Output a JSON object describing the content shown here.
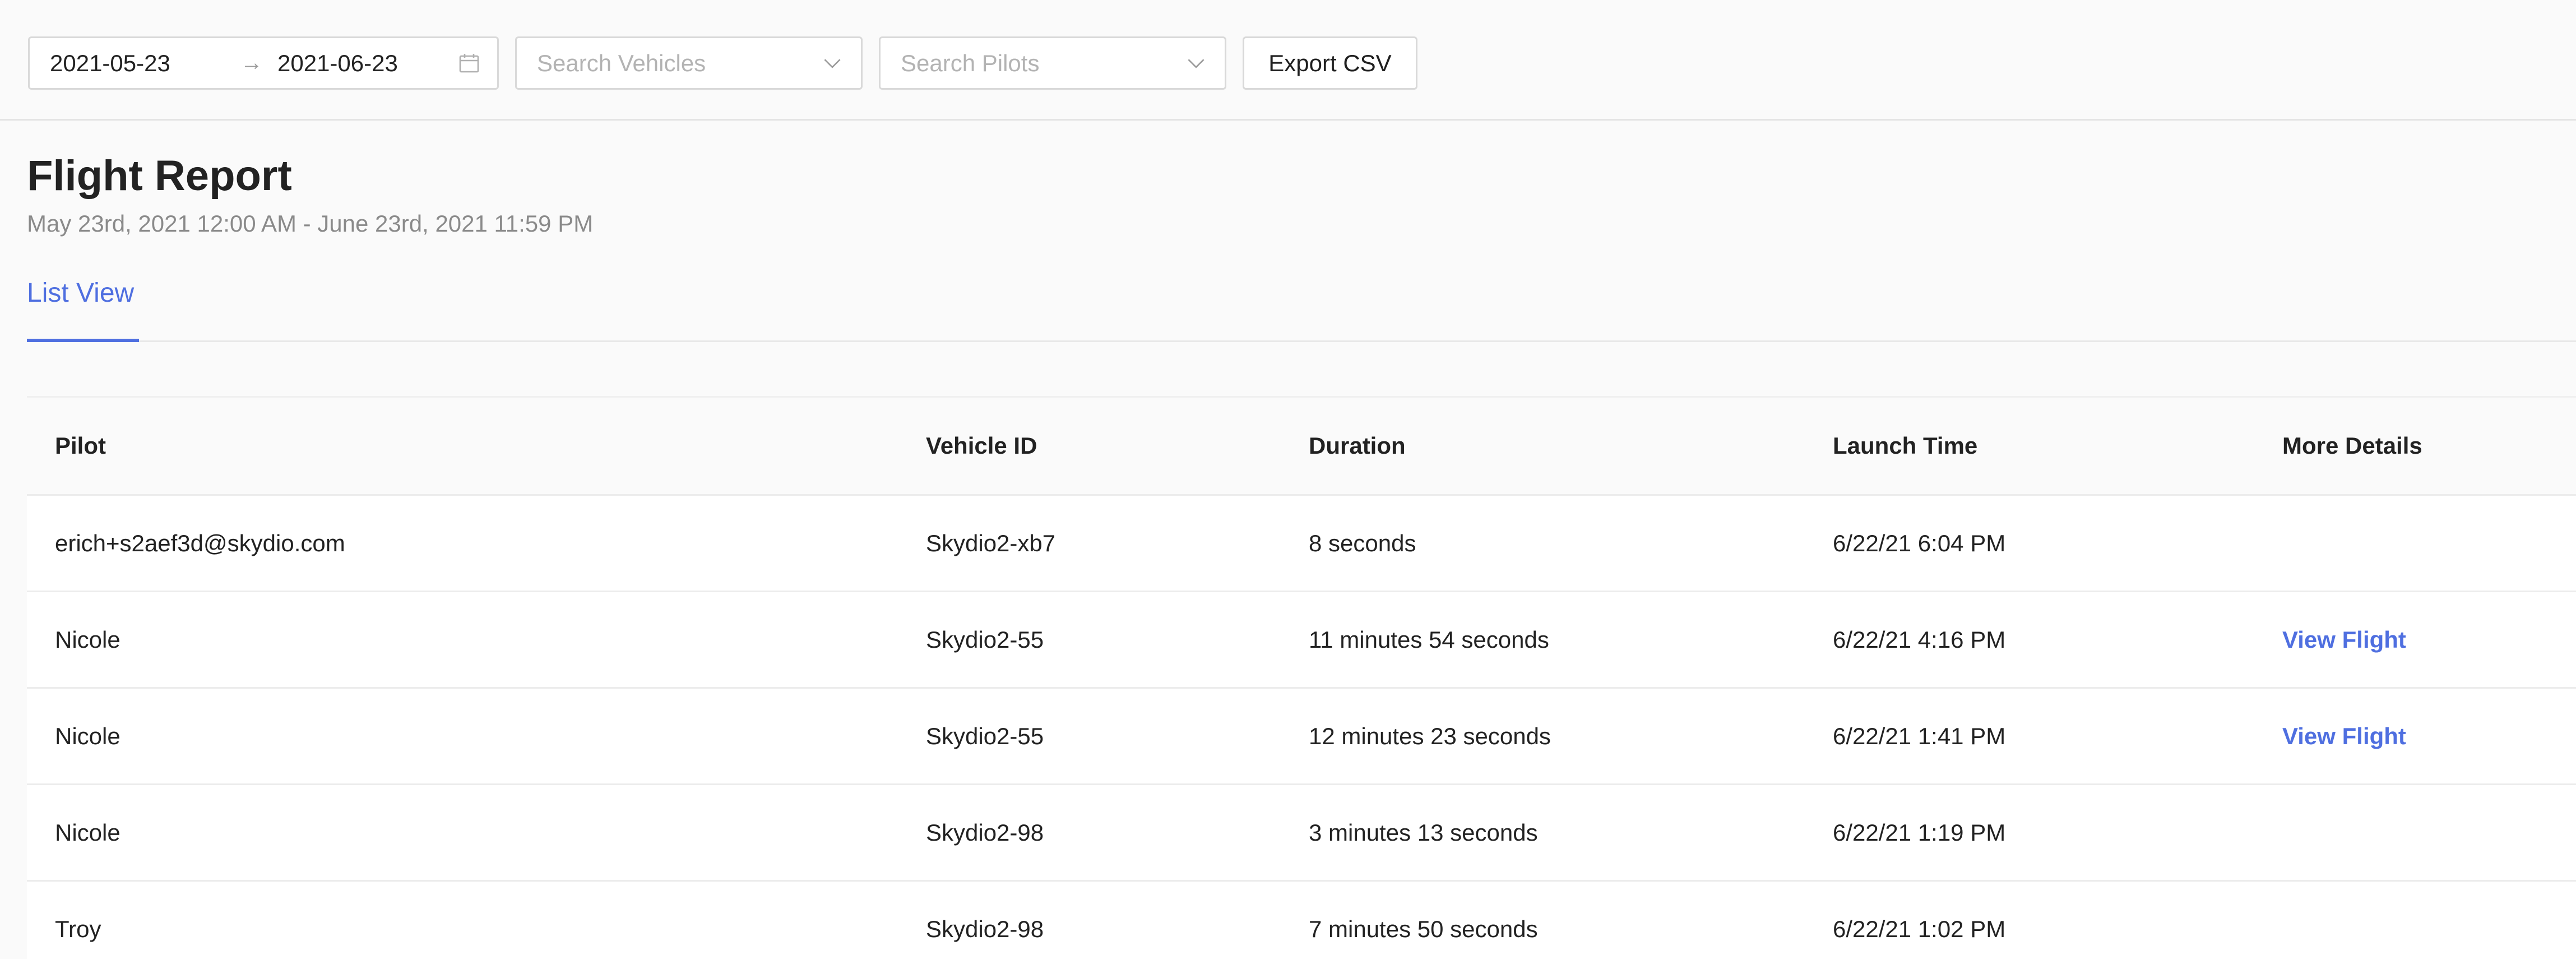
{
  "toolbar": {
    "date_start": "2021-05-23",
    "date_end": "2021-06-23",
    "arrow": "→",
    "vehicles_placeholder": "Search Vehicles",
    "pilots_placeholder": "Search Pilots",
    "export_label": "Export CSV"
  },
  "header": {
    "title": "Flight Report",
    "subtitle": "May 23rd, 2021 12:00 AM - June 23rd, 2021 11:59 PM"
  },
  "tabs": [
    {
      "label": "List View",
      "active": true
    }
  ],
  "table": {
    "columns": [
      "Pilot",
      "Vehicle ID",
      "Duration",
      "Launch Time",
      "More Details"
    ],
    "rows": [
      {
        "pilot": "erich+s2aef3d@skydio.com",
        "vehicle": "Skydio2-xb7",
        "duration": "8 seconds",
        "launch": "6/22/21 6:04 PM",
        "more": ""
      },
      {
        "pilot": "Nicole",
        "vehicle": "Skydio2-55",
        "duration": "11 minutes 54 seconds",
        "launch": "6/22/21 4:16 PM",
        "more": "View Flight"
      },
      {
        "pilot": "Nicole",
        "vehicle": "Skydio2-55",
        "duration": "12 minutes 23 seconds",
        "launch": "6/22/21 1:41 PM",
        "more": "View Flight"
      },
      {
        "pilot": "Nicole",
        "vehicle": "Skydio2-98",
        "duration": "3 minutes 13 seconds",
        "launch": "6/22/21 1:19 PM",
        "more": ""
      },
      {
        "pilot": "Troy",
        "vehicle": "Skydio2-98",
        "duration": "7 minutes 50 seconds",
        "launch": "6/22/21 1:02 PM",
        "more": ""
      }
    ]
  },
  "colors": {
    "accent": "#4f6fe0",
    "background": "#fafafa",
    "border": "#d9d9d9"
  },
  "icons": {
    "date_picker": "calendar-icon",
    "dropdown": "chevron-down-icon"
  }
}
